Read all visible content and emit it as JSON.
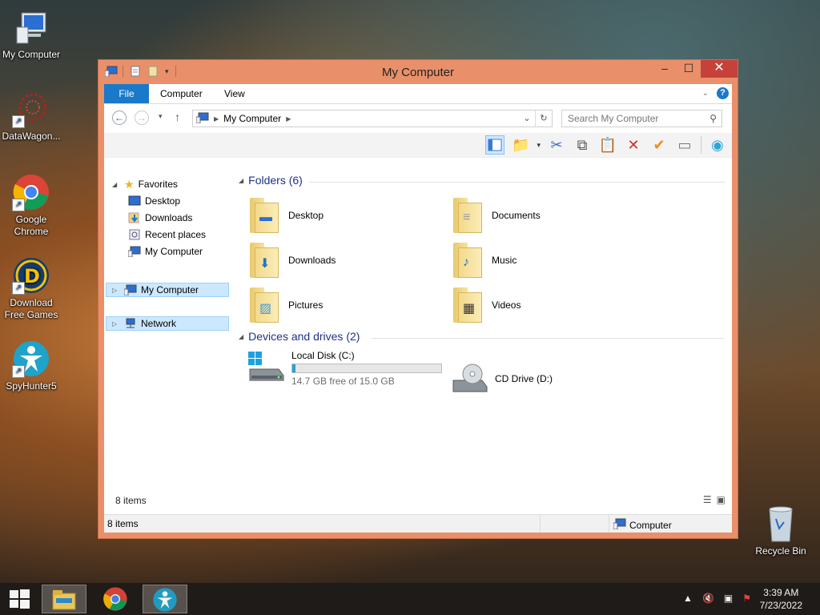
{
  "desktop": {
    "icons": [
      {
        "label": "My Computer"
      },
      {
        "label": "DataWagon..."
      },
      {
        "label": "Google Chrome"
      },
      {
        "label": "Download Free Games"
      },
      {
        "label": "SpyHunter5"
      },
      {
        "label": "Recycle Bin"
      }
    ]
  },
  "window": {
    "title": "My Computer",
    "tabs": {
      "file": "File",
      "computer": "Computer",
      "view": "View"
    },
    "address": {
      "crumb": "My Computer"
    },
    "search": {
      "placeholder": "Search My Computer"
    },
    "nav": {
      "favorites": "Favorites",
      "fav_items": [
        "Desktop",
        "Downloads",
        "Recent places",
        "My Computer"
      ],
      "my_computer": "My Computer",
      "network": "Network"
    },
    "folders": {
      "header": "Folders (6)",
      "items": [
        "Desktop",
        "Documents",
        "Downloads",
        "Music",
        "Pictures",
        "Videos"
      ]
    },
    "devices": {
      "header": "Devices and drives (2)",
      "local_disk": {
        "name": "Local Disk (C:)",
        "free": "14.7 GB free of 15.0 GB",
        "used_fraction": 0.02
      },
      "cd_drive": {
        "name": "CD Drive (D:)"
      }
    },
    "status": {
      "items": "8 items",
      "bar_items": "8 items",
      "location": "Computer"
    }
  },
  "taskbar": {
    "time": "3:39 AM",
    "date": "7/23/2022"
  },
  "colors": {
    "accent": "#1979ca",
    "titlebar": "#e9906a",
    "close": "#c7413b"
  }
}
